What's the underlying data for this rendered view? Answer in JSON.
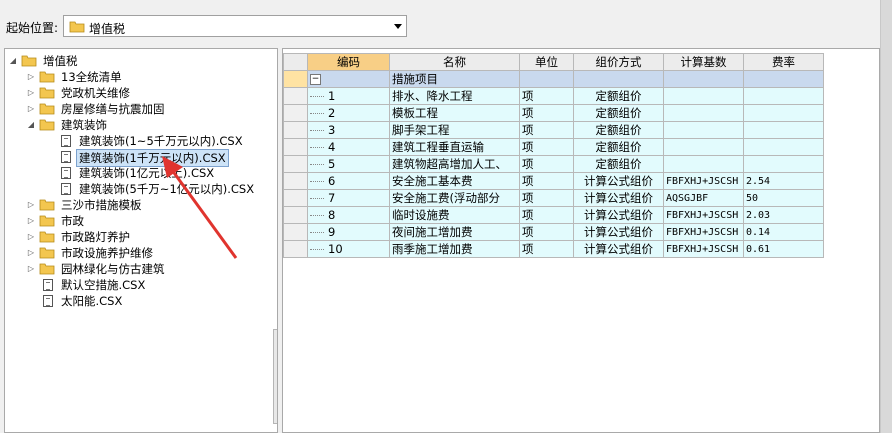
{
  "header": {
    "start_label": "起始位置:",
    "start_value": "增值税"
  },
  "tree": {
    "root": "增值税",
    "items": [
      {
        "label": "13全统清单",
        "kind": "folder"
      },
      {
        "label": "党政机关维修",
        "kind": "folder"
      },
      {
        "label": "房屋修缮与抗震加固",
        "kind": "folder"
      },
      {
        "label": "建筑装饰",
        "kind": "folder-open"
      },
      {
        "label": "建筑装饰(1~5千万元以内).CSX",
        "kind": "file"
      },
      {
        "label": "建筑装饰(1千万元以内).CSX",
        "kind": "file-selected"
      },
      {
        "label": "建筑装饰(1亿元以上).CSX",
        "kind": "file"
      },
      {
        "label": "建筑装饰(5千万~1亿元以内).CSX",
        "kind": "file"
      },
      {
        "label": "三沙市措施模板",
        "kind": "folder"
      },
      {
        "label": "市政",
        "kind": "folder"
      },
      {
        "label": "市政路灯养护",
        "kind": "folder"
      },
      {
        "label": "市政设施养护维修",
        "kind": "folder"
      },
      {
        "label": "园林绿化与仿古建筑",
        "kind": "folder"
      },
      {
        "label": "默认空措施.CSX",
        "kind": "file"
      },
      {
        "label": "太阳能.CSX",
        "kind": "file"
      }
    ]
  },
  "grid": {
    "headers": [
      "编码",
      "名称",
      "单位",
      "组价方式",
      "计算基数",
      "费率"
    ],
    "group_row": {
      "name": "措施项目"
    },
    "rows": [
      {
        "code": "1",
        "name": "排水、降水工程",
        "unit": "项",
        "method": "定额组价",
        "base": "",
        "rate": ""
      },
      {
        "code": "2",
        "name": "模板工程",
        "unit": "项",
        "method": "定额组价",
        "base": "",
        "rate": ""
      },
      {
        "code": "3",
        "name": "脚手架工程",
        "unit": "项",
        "method": "定额组价",
        "base": "",
        "rate": ""
      },
      {
        "code": "4",
        "name": "建筑工程垂直运输",
        "unit": "项",
        "method": "定额组价",
        "base": "",
        "rate": ""
      },
      {
        "code": "5",
        "name": "建筑物超高增加人工、",
        "unit": "项",
        "method": "定额组价",
        "base": "",
        "rate": ""
      },
      {
        "code": "6",
        "name": "安全施工基本费",
        "unit": "项",
        "method": "计算公式组价",
        "base": "FBFXHJ+JSCSH",
        "rate": "2.54"
      },
      {
        "code": "7",
        "name": "安全施工费(浮动部分",
        "unit": "项",
        "method": "计算公式组价",
        "base": "AQSGJBF",
        "rate": "50"
      },
      {
        "code": "8",
        "name": "临时设施费",
        "unit": "项",
        "method": "计算公式组价",
        "base": "FBFXHJ+JSCSH",
        "rate": "2.03"
      },
      {
        "code": "9",
        "name": "夜间施工增加费",
        "unit": "项",
        "method": "计算公式组价",
        "base": "FBFXHJ+JSCSH",
        "rate": "0.14"
      },
      {
        "code": "10",
        "name": "雨季施工增加费",
        "unit": "项",
        "method": "计算公式组价",
        "base": "FBFXHJ+JSCSH",
        "rate": "0.61"
      }
    ]
  },
  "colors": {
    "header_code": "#f8cf86",
    "group_row": "#c9d9ee",
    "data_row": "#e2fbfd",
    "arrow": "#e0342e",
    "folder": "#f3c64f"
  }
}
